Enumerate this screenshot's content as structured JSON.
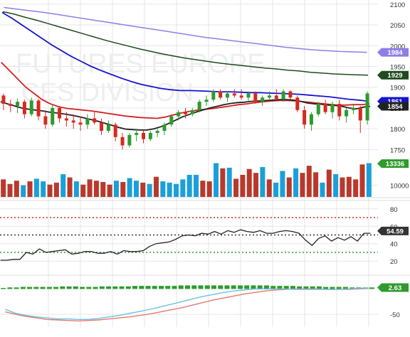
{
  "watermark": {
    "line1": "FUTURES EUROPE",
    "line2": "CES DIVISION"
  },
  "colors": {
    "up": "#2e9a2e",
    "down": "#d62a1e",
    "volume_up": "#1aa0d8",
    "volume_down": "#b8392c",
    "sma_fast": "#222222",
    "sma_mid": "#d71f1f",
    "sma_blue": "#1414d2",
    "sma_green": "#1f4a1f",
    "sma_purple": "#8e7ee6",
    "rsi_line": "#222222",
    "rsi_upper": "#d62a1e",
    "rsi_mid": "#333333",
    "rsi_lower": "#2e9a2e",
    "macd_hist": "#2e9a2e",
    "macd_line": "#6cc1e6",
    "macd_signal": "#e57a6c",
    "grid": "#e6e6e6",
    "axis_text": "#333333"
  },
  "chart_data": [
    {
      "type": "candlestick",
      "panel": "price",
      "yticks": [
        1750,
        1800,
        1850,
        1900,
        1950,
        2000,
        2050,
        2100
      ],
      "ylim": [
        1730,
        2110
      ],
      "badges": [
        {
          "label": "1984",
          "value": 1984,
          "series": "sma_purple"
        },
        {
          "label": "1929",
          "value": 1929,
          "series": "sma_green"
        },
        {
          "label": "1861",
          "value": 1866,
          "series": "sma_blue"
        },
        {
          "label": "1854",
          "value": 1854,
          "series": "sma_fast"
        }
      ],
      "candles": [
        [
          1880,
          1885,
          1845,
          1860
        ],
        [
          1860,
          1870,
          1840,
          1855
        ],
        [
          1855,
          1872,
          1838,
          1865
        ],
        [
          1865,
          1870,
          1825,
          1835
        ],
        [
          1835,
          1875,
          1830,
          1868
        ],
        [
          1868,
          1872,
          1820,
          1830
        ],
        [
          1830,
          1845,
          1800,
          1810
        ],
        [
          1810,
          1860,
          1805,
          1850
        ],
        [
          1850,
          1855,
          1815,
          1825
        ],
        [
          1825,
          1840,
          1805,
          1820
        ],
        [
          1820,
          1835,
          1800,
          1815
        ],
        [
          1815,
          1830,
          1795,
          1810
        ],
        [
          1810,
          1835,
          1800,
          1825
        ],
        [
          1825,
          1840,
          1810,
          1815
        ],
        [
          1815,
          1825,
          1785,
          1795
        ],
        [
          1795,
          1820,
          1790,
          1810
        ],
        [
          1810,
          1815,
          1770,
          1780
        ],
        [
          1780,
          1790,
          1750,
          1760
        ],
        [
          1760,
          1790,
          1755,
          1785
        ],
        [
          1785,
          1800,
          1770,
          1790
        ],
        [
          1790,
          1795,
          1765,
          1775
        ],
        [
          1775,
          1795,
          1770,
          1790
        ],
        [
          1790,
          1800,
          1780,
          1795
        ],
        [
          1795,
          1815,
          1785,
          1810
        ],
        [
          1810,
          1835,
          1805,
          1830
        ],
        [
          1830,
          1845,
          1820,
          1840
        ],
        [
          1840,
          1850,
          1825,
          1835
        ],
        [
          1835,
          1850,
          1830,
          1845
        ],
        [
          1845,
          1870,
          1840,
          1865
        ],
        [
          1865,
          1880,
          1855,
          1870
        ],
        [
          1870,
          1895,
          1865,
          1890
        ],
        [
          1890,
          1895,
          1870,
          1875
        ],
        [
          1875,
          1890,
          1865,
          1885
        ],
        [
          1885,
          1895,
          1875,
          1880
        ],
        [
          1880,
          1895,
          1870,
          1875
        ],
        [
          1875,
          1890,
          1865,
          1885
        ],
        [
          1885,
          1890,
          1860,
          1865
        ],
        [
          1865,
          1880,
          1855,
          1875
        ],
        [
          1875,
          1890,
          1868,
          1880
        ],
        [
          1880,
          1895,
          1870,
          1872
        ],
        [
          1872,
          1895,
          1865,
          1890
        ],
        [
          1890,
          1893,
          1870,
          1875
        ],
        [
          1875,
          1880,
          1840,
          1845
        ],
        [
          1845,
          1855,
          1800,
          1810
        ],
        [
          1810,
          1840,
          1795,
          1835
        ],
        [
          1835,
          1865,
          1830,
          1860
        ],
        [
          1860,
          1870,
          1835,
          1840
        ],
        [
          1840,
          1865,
          1825,
          1860
        ],
        [
          1860,
          1870,
          1820,
          1830
        ],
        [
          1830,
          1850,
          1815,
          1845
        ],
        [
          1845,
          1860,
          1835,
          1850
        ],
        [
          1850,
          1855,
          1790,
          1820
        ],
        [
          1820,
          1890,
          1810,
          1885
        ]
      ]
    },
    {
      "type": "bar",
      "panel": "volume",
      "yticks": [
        10000
      ],
      "ylim": [
        8200,
        14000
      ],
      "badge": {
        "label": "13336",
        "value": 13336
      },
      "values": [
        10900,
        10200,
        10700,
        10000,
        10600,
        11000,
        10600,
        10100,
        10400,
        11700,
        11200,
        10600,
        10100,
        10900,
        10700,
        10500,
        10100,
        10700,
        10500,
        11100,
        10700,
        10400,
        10200,
        11300,
        10600,
        10400,
        10200,
        10900,
        11600,
        11600,
        10700,
        10600,
        13400,
        12600,
        12700,
        11000,
        11600,
        12500,
        11900,
        12800,
        10900,
        10400,
        12200,
        11200,
        12600,
        11900,
        13000,
        12000,
        10400,
        12400,
        11700,
        11200,
        11300,
        10900,
        13200,
        13400
      ],
      "up": [
        false,
        false,
        false,
        true,
        false,
        true,
        true,
        false,
        false,
        true,
        false,
        true,
        false,
        false,
        false,
        false,
        false,
        true,
        false,
        true,
        true,
        false,
        true,
        false,
        true,
        true,
        true,
        true,
        true,
        true,
        false,
        false,
        true,
        false,
        true,
        false,
        false,
        false,
        false,
        true,
        false,
        true,
        true,
        false,
        true,
        false,
        false,
        false,
        true,
        false,
        true,
        false,
        false,
        false,
        false,
        true
      ]
    },
    {
      "type": "line",
      "panel": "rsi",
      "yticks": [
        20,
        40,
        60,
        80
      ],
      "ylim": [
        12,
        88
      ],
      "levels": [
        70,
        50,
        30
      ],
      "badge": {
        "label": "54.59",
        "value": 54.59
      },
      "values": [
        21,
        21,
        22,
        22,
        30,
        28,
        34,
        30,
        31,
        32,
        33,
        28,
        29,
        31,
        31,
        29,
        29,
        31,
        28,
        32,
        31,
        31,
        32,
        37,
        40,
        41,
        42,
        45,
        49,
        50,
        49,
        52,
        51,
        54,
        51,
        55,
        53,
        56,
        54,
        53,
        55,
        52,
        52,
        54,
        55,
        54,
        52,
        44,
        38,
        46,
        49,
        43,
        47,
        44,
        48,
        43,
        52,
        52
      ]
    },
    {
      "type": "bar",
      "panel": "macd",
      "yticks": [
        -50
      ],
      "ylim": [
        -68,
        16
      ],
      "badge": {
        "label": "2.63",
        "value": 2.63
      },
      "hist": [
        2,
        3,
        3,
        4,
        4,
        4,
        4,
        4,
        4,
        5,
        5,
        5,
        4,
        4,
        4,
        5,
        5,
        5,
        5,
        5,
        6,
        6,
        6,
        6,
        6,
        6,
        6,
        7,
        7,
        7,
        7,
        7,
        7,
        7,
        7,
        7,
        7,
        7,
        7,
        7,
        7,
        6,
        6,
        6,
        6,
        5,
        5,
        5,
        5,
        4,
        4,
        4,
        4,
        3,
        3,
        3,
        3
      ],
      "macd": [
        -40,
        -48,
        -52,
        -55,
        -57,
        -59,
        -59,
        -60,
        -60,
        -58,
        -55,
        -52,
        -48,
        -44,
        -40,
        -35,
        -30,
        -25,
        -20,
        -15,
        -11,
        -7,
        -4,
        -2,
        0,
        0,
        0,
        0,
        -1,
        -1,
        -1,
        -1,
        -1,
        0,
        1,
        2
      ],
      "signal": [
        -45,
        -50,
        -54,
        -57,
        -60,
        -61,
        -62,
        -63,
        -62,
        -61,
        -59,
        -57,
        -55,
        -52,
        -49,
        -45,
        -41,
        -37,
        -32,
        -27,
        -22,
        -18,
        -14,
        -10,
        -7,
        -4,
        -2,
        -1,
        0,
        0,
        0,
        -1,
        -1,
        -1,
        0,
        1
      ]
    }
  ],
  "ma_lines": {
    "sma_fast": [
      1865,
      1860,
      1855,
      1850,
      1847,
      1845,
      1843,
      1840,
      1838,
      1836,
      1833,
      1830,
      1826,
      1822,
      1818,
      1813,
      1808,
      1803,
      1799,
      1798,
      1797,
      1797,
      1800,
      1805,
      1812,
      1820,
      1828,
      1834,
      1840,
      1845,
      1850,
      1854,
      1858,
      1861,
      1863,
      1864,
      1866,
      1867,
      1868,
      1869,
      1870,
      1870,
      1869,
      1866,
      1862,
      1860,
      1859,
      1857,
      1856,
      1854,
      1850,
      1848,
      1852,
      1854
    ],
    "sma_mid": [
      1960,
      1940,
      1920,
      1900,
      1885,
      1870,
      1860,
      1853,
      1849,
      1847,
      1845,
      1843,
      1840,
      1837,
      1834,
      1831,
      1829,
      1827,
      1826,
      1825,
      1828,
      1833,
      1838,
      1842,
      1845,
      1847,
      1849,
      1852,
      1855,
      1858,
      1860,
      1863,
      1865,
      1867,
      1868,
      1868,
      1867,
      1865,
      1863,
      1861,
      1859,
      1857,
      1857,
      1858,
      1858,
      1860
    ],
    "sma_blue": [
      2080,
      2066,
      2050,
      2034,
      2018,
      2002,
      1988,
      1974,
      1962,
      1950,
      1940,
      1931,
      1922,
      1914,
      1907,
      1902,
      1897,
      1894,
      1892,
      1892,
      1891,
      1890,
      1889,
      1889,
      1888,
      1887,
      1887,
      1886,
      1885,
      1884,
      1883,
      1881,
      1879,
      1877,
      1874,
      1871,
      1869,
      1866
    ],
    "sma_green": [
      2082,
      2076,
      2068,
      2061,
      2053,
      2045,
      2037,
      2029,
      2021,
      2013,
      2006,
      1999,
      1992,
      1986,
      1980,
      1975,
      1970,
      1966,
      1962,
      1958,
      1955,
      1952,
      1949,
      1946,
      1944,
      1941,
      1939,
      1936,
      1934,
      1932,
      1931,
      1930,
      1929
    ],
    "sma_purple": [
      2092,
      2088,
      2084,
      2080,
      2075,
      2070,
      2065,
      2060,
      2055,
      2050,
      2045,
      2040,
      2035,
      2030,
      2025,
      2020,
      2016,
      2012,
      2008,
      2004,
      2000,
      1996,
      1993,
      1990,
      1988,
      1986,
      1985,
      1984
    ]
  }
}
